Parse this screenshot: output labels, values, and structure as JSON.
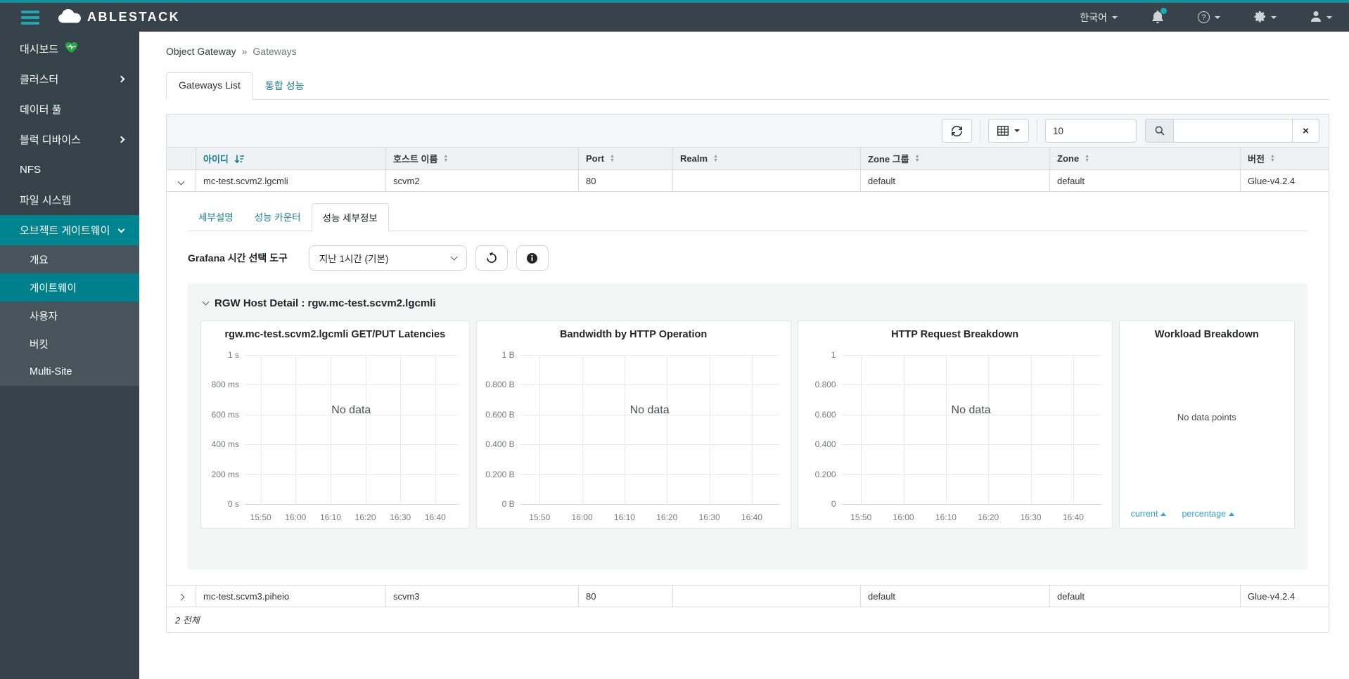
{
  "navbar": {
    "brand": "ABLESTACK",
    "language": "한국어"
  },
  "sidebar": {
    "items": [
      {
        "label": "대시보드"
      },
      {
        "label": "클러스터"
      },
      {
        "label": "데이터 풀"
      },
      {
        "label": "블럭 디바이스"
      },
      {
        "label": "NFS"
      },
      {
        "label": "파일 시스템"
      },
      {
        "label": "오브젝트 게이트웨이"
      }
    ],
    "submenu": [
      {
        "label": "개요"
      },
      {
        "label": "게이트웨이"
      },
      {
        "label": "사용자"
      },
      {
        "label": "버킷"
      },
      {
        "label": "Multi-Site"
      }
    ]
  },
  "breadcrumb": {
    "section": "Object Gateway",
    "separator": "»",
    "page": "Gateways"
  },
  "tabs": [
    {
      "label": "Gateways List"
    },
    {
      "label": "통합 성능"
    }
  ],
  "toolbar": {
    "page_size": "10",
    "search_value": "",
    "clear_label": "×"
  },
  "table": {
    "columns": [
      "아이디",
      "호스트 이름",
      "Port",
      "Realm",
      "Zone 그룹",
      "Zone",
      "버전"
    ],
    "rows": [
      {
        "cells": [
          "mc-test.scvm2.lgcmli",
          "scvm2",
          "80",
          "",
          "default",
          "default",
          "Glue-v4.2.4"
        ],
        "expanded": true
      },
      {
        "cells": [
          "mc-test.scvm3.piheio",
          "scvm3",
          "80",
          "",
          "default",
          "default",
          "Glue-v4.2.4"
        ],
        "expanded": false
      }
    ]
  },
  "detail": {
    "tabs": [
      {
        "label": "세부설명"
      },
      {
        "label": "성능 카운터"
      },
      {
        "label": "성능 세부정보"
      }
    ],
    "grafana_label": "Grafana 시간 선택 도구",
    "time_select": "지난 1시간 (기본)"
  },
  "grafana": {
    "section_title": "RGW Host Detail : rgw.mc-test.scvm2.lgcmli"
  },
  "chart_data": [
    {
      "type": "line",
      "title": "rgw.mc-test.scvm2.lgcmli GET/PUT Latencies",
      "x_ticks": [
        "15:50",
        "16:00",
        "16:10",
        "16:20",
        "16:30",
        "16:40"
      ],
      "y_ticks": [
        "1 s",
        "800 ms",
        "600 ms",
        "400 ms",
        "200 ms",
        "0 s"
      ],
      "ylim": [
        0,
        1
      ],
      "series": [],
      "no_data": "No data",
      "grid": true,
      "legend": "none"
    },
    {
      "type": "line",
      "title": "Bandwidth by HTTP Operation",
      "x_ticks": [
        "15:50",
        "16:00",
        "16:10",
        "16:20",
        "16:30",
        "16:40"
      ],
      "y_ticks": [
        "1 B",
        "0.800 B",
        "0.600 B",
        "0.400 B",
        "0.200 B",
        "0 B"
      ],
      "ylim": [
        0,
        1
      ],
      "series": [],
      "no_data": "No data",
      "grid": true,
      "legend": "none"
    },
    {
      "type": "line",
      "title": "HTTP Request Breakdown",
      "x_ticks": [
        "15:50",
        "16:00",
        "16:10",
        "16:20",
        "16:30",
        "16:40"
      ],
      "y_ticks": [
        "1",
        "0.800",
        "0.600",
        "0.400",
        "0.200",
        "0"
      ],
      "ylim": [
        0,
        1
      ],
      "series": [],
      "no_data": "No data",
      "grid": true,
      "legend": "none"
    },
    {
      "type": "pie",
      "title": "Workload Breakdown",
      "values": [],
      "no_data": "No data points",
      "links": [
        {
          "label": "current"
        },
        {
          "label": "percentage"
        }
      ]
    }
  ],
  "footer": {
    "total": "2 전체"
  }
}
